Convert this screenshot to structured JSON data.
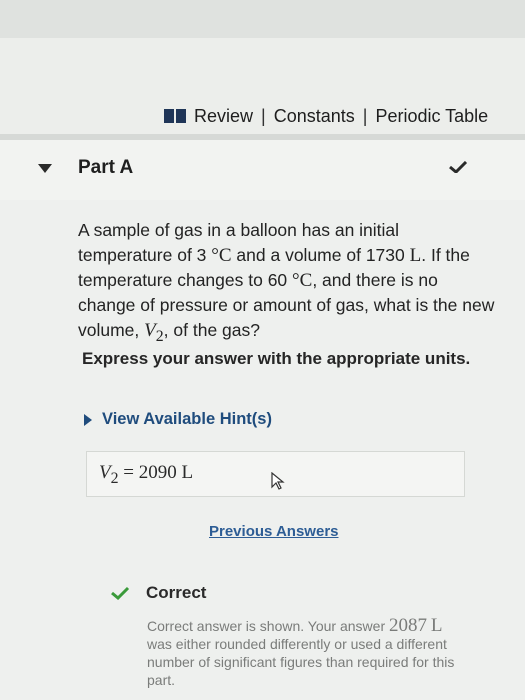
{
  "header": {
    "links": [
      "Review",
      "Constants",
      "Periodic Table"
    ],
    "separator": "|"
  },
  "part": {
    "title": "Part A"
  },
  "question": {
    "t1": "A sample of gas in a balloon has an initial temperature of ",
    "temp1": "3",
    "deg1": "°C",
    "t2": " and a volume of ",
    "vol1": "1730",
    "unit1": "L",
    "t3": ". If the temperature changes to ",
    "temp2": "60",
    "deg2": "°C",
    "t4": ", and there is no change of pressure or amount of gas, what is the new volume, ",
    "var": "V",
    "sub": "2",
    "t5": ", of the gas?"
  },
  "instruction": "Express your answer with the appropriate units.",
  "hints_label": "View Available Hint(s)",
  "answer": {
    "var": "V",
    "sub": "2",
    "equals": "=",
    "value": "2090",
    "unit": "L"
  },
  "previous_answers_label": "Previous Answers",
  "feedback": {
    "status": "Correct",
    "f1": "Correct answer is shown. Your answer ",
    "value": "2087",
    "unit": "L",
    "f2": " was either rounded differently or used a different number of significant figures than required for this part."
  },
  "colors": {
    "link_blue": "#1f4c7d",
    "check_green": "#3a9a3a"
  }
}
